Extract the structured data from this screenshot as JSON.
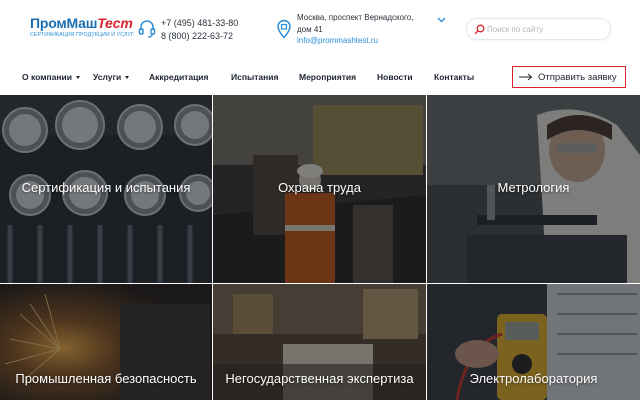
{
  "header": {
    "logo": {
      "main": "ПромМаш",
      "accent": "Тест",
      "subtitle": "СЕРТИФИКАЦИЯ ПРОДУКЦИИ И УСЛУГ"
    },
    "phones": [
      "+7 (495) 481-33-80",
      "8 (800) 222-63-72"
    ],
    "address": {
      "line1": "Москва, проспект Вернадского,",
      "line2": "дом 41",
      "email": "info@prommashtest.ru"
    },
    "search": {
      "placeholder": "Поиск по сайту",
      "value": ""
    }
  },
  "nav": {
    "items": [
      {
        "label": "О компании",
        "dropdown": true
      },
      {
        "label": "Услуги",
        "dropdown": true
      },
      {
        "label": "Аккредитация"
      },
      {
        "label": "Испытания"
      },
      {
        "label": "Мероприятия"
      },
      {
        "label": "Новости"
      },
      {
        "label": "Контакты"
      }
    ],
    "cta": "Отправить заявку"
  },
  "tiles": [
    {
      "title": "Сертификация и испытания",
      "image": "pressure-gauges-photo"
    },
    {
      "title": "Охрана труда",
      "image": "industrial-workers-photo"
    },
    {
      "title": "Метрология",
      "image": "laboratory-photo"
    },
    {
      "title": "Промышленная безопасность",
      "image": "welding-sparks-photo"
    },
    {
      "title": "Негосударственная экспертиза",
      "image": "office-documents-photo"
    },
    {
      "title": "Электролаборатория",
      "image": "multimeter-photo"
    }
  ],
  "colors": {
    "brand_blue": "#1b6fb0",
    "brand_red": "#d8232a",
    "link_blue": "#2a8dd6",
    "text_dark": "#1e2530"
  }
}
